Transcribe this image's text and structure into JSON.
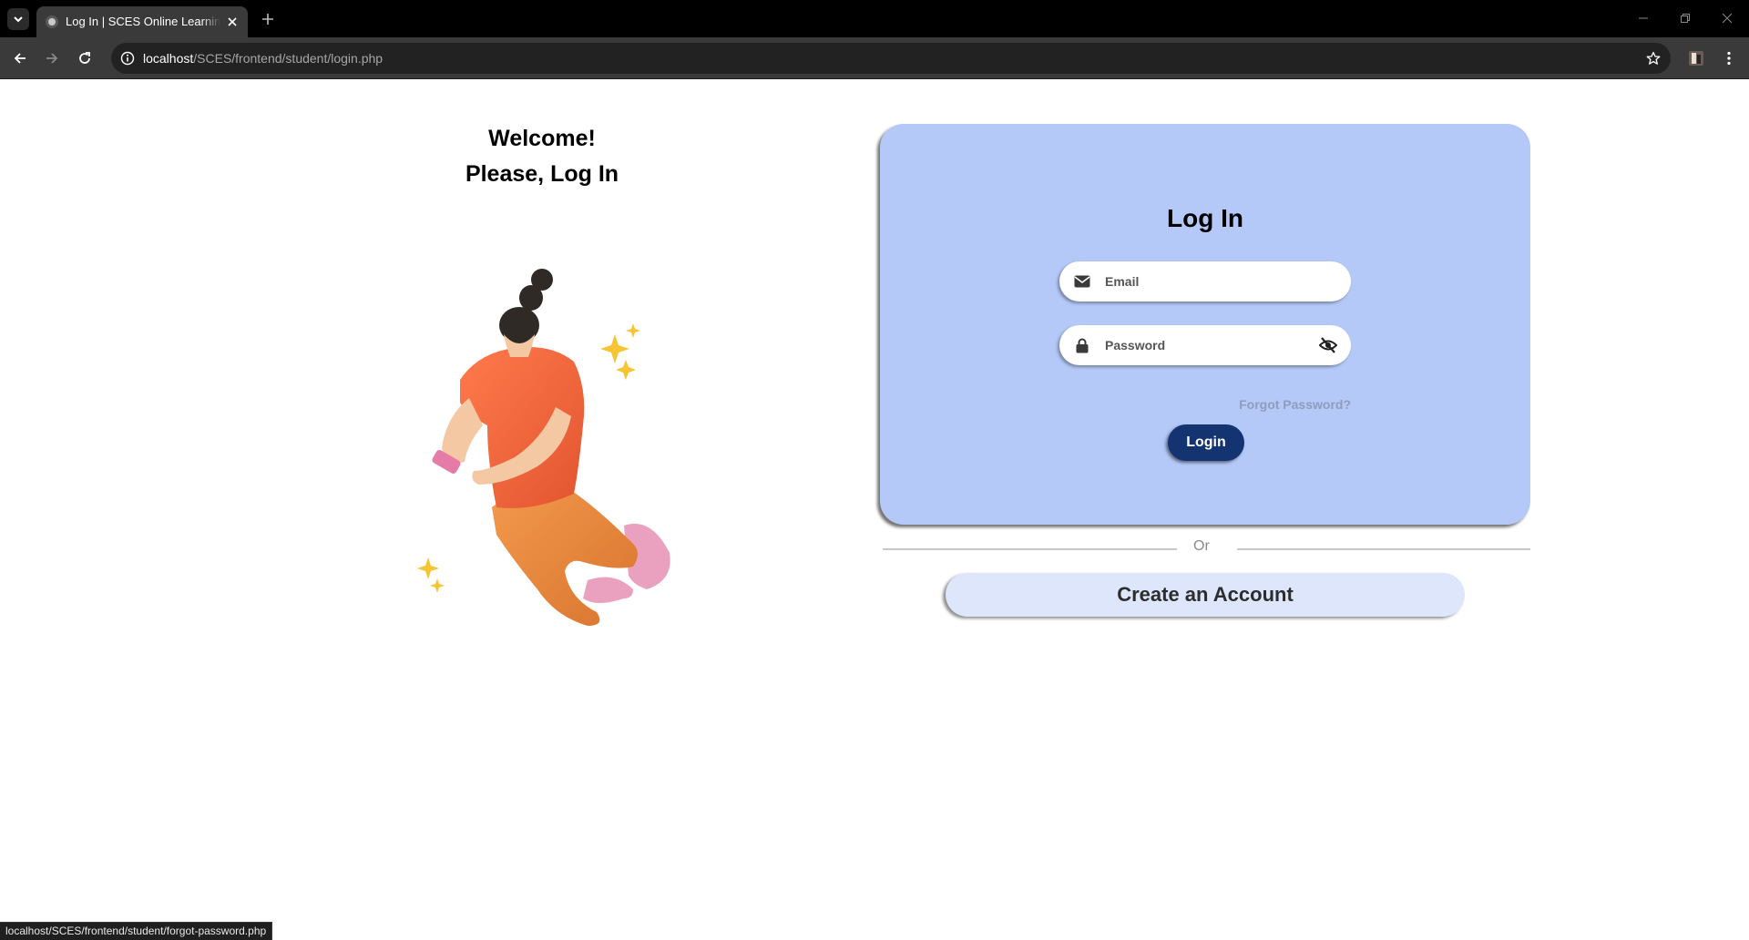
{
  "browser": {
    "tab_title": "Log In | SCES Online Learning Portal",
    "url_host": "localhost",
    "url_path": "/SCES/frontend/student/login.php",
    "status_url": "localhost/SCES/frontend/student/forgot-password.php"
  },
  "welcome": {
    "line1": "Welcome!",
    "line2": "Please, Log In"
  },
  "login_card": {
    "title": "Log In",
    "email_placeholder": "Email",
    "password_placeholder": "Password",
    "forgot_label": "Forgot Password?",
    "login_label": "Login"
  },
  "divider_text": "Or",
  "create_account_label": "Create an Account",
  "colors": {
    "card_bg": "#b4c9f8",
    "login_button": "#143371",
    "create_button": "#dde6fb"
  }
}
